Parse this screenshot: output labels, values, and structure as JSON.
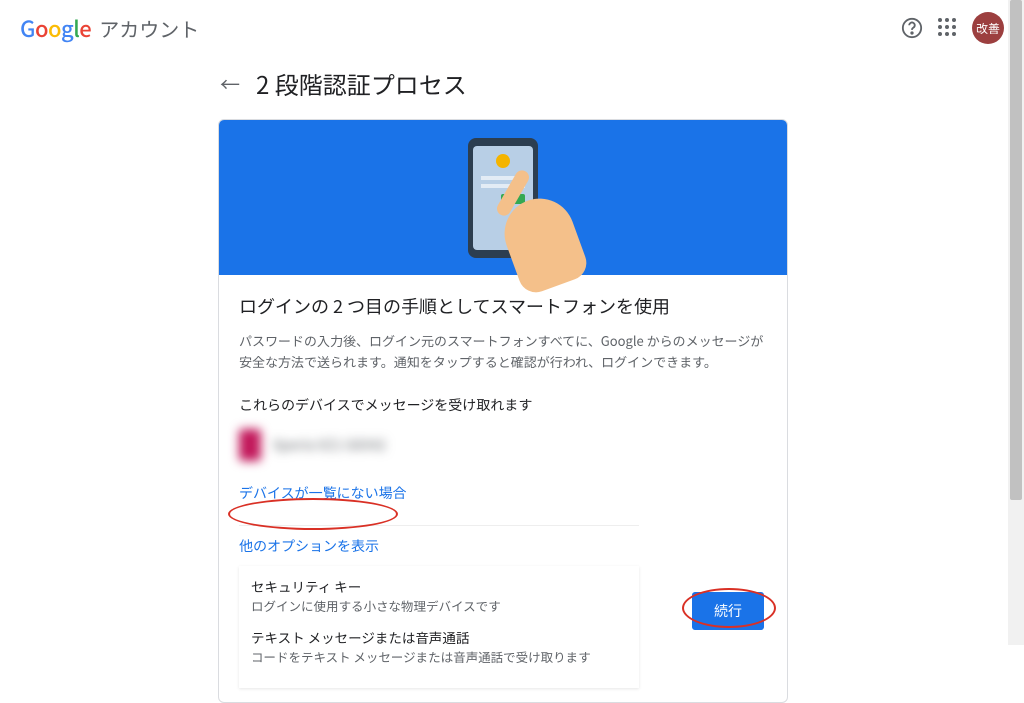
{
  "header": {
    "logo_g1": "G",
    "logo_o1": "o",
    "logo_o2": "o",
    "logo_g2": "g",
    "logo_l": "l",
    "logo_e": "e",
    "account_label": "アカウント",
    "avatar_text": "改善"
  },
  "page": {
    "title": "2 段階認証プロセス"
  },
  "card": {
    "section_title": "ログインの 2 つ目の手順としてスマートフォンを使用",
    "section_desc": "パスワードの入力後、ログイン元のスマートフォンすべてに、Google からのメッセージが安全な方法で送られます。通知をタップすると確認が行われ、ログインできます。",
    "devices_label": "これらのデバイスでメッセージを受け取れます",
    "device_name": "Xperia XZ1 G8342",
    "not_listed_link": "デバイスが一覧にない場合",
    "options_toggle": "他のオプションを表示",
    "options": [
      {
        "title": "セキュリティ キー",
        "desc": "ログインに使用する小さな物理デバイスです"
      },
      {
        "title": "テキスト メッセージまたは音声通話",
        "desc": "コードをテキスト メッセージまたは音声通話で受け取ります"
      }
    ],
    "continue_label": "続行"
  }
}
